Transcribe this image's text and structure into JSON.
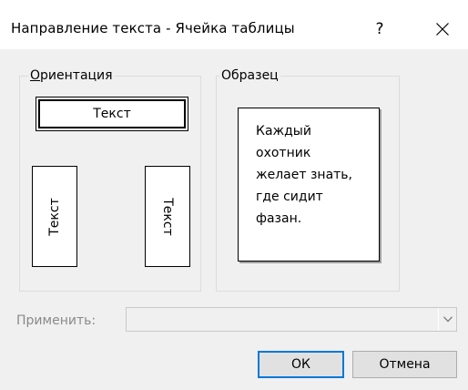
{
  "window": {
    "title": "Направление текста - Ячейка таблицы",
    "help_label": "?",
    "close_icon": "close-icon"
  },
  "orientation": {
    "group_label": "Ориентация",
    "options": [
      {
        "label": "Текст",
        "direction": "horizontal",
        "selected": true
      },
      {
        "label": "Текст",
        "direction": "vertical-bottom-to-top",
        "selected": false
      },
      {
        "label": "Текст",
        "direction": "vertical-top-to-bottom",
        "selected": false
      }
    ]
  },
  "sample": {
    "group_label": "Образец",
    "lines": [
      "Каждый",
      "охотник",
      "желает знать,",
      "где сидит",
      "фазан."
    ]
  },
  "apply": {
    "label": "Применить:",
    "value": "",
    "enabled": false
  },
  "buttons": {
    "ok_label": "ОК",
    "cancel_label": "Отмена"
  },
  "colors": {
    "content_background": "#f0f0f0",
    "default_button_border": "#0078d7",
    "disabled_text": "#8a8a8a"
  }
}
